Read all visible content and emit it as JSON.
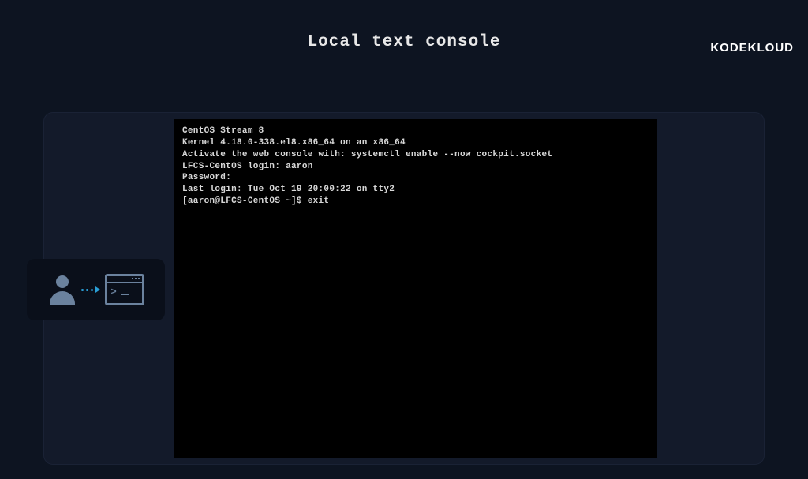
{
  "brand": "KODEKLOUD",
  "title": "Local text console",
  "terminal": {
    "lines": [
      "CentOS Stream 8",
      "Kernel 4.18.0-338.el8.x86_64 on an x86_64",
      "",
      "Activate the web console with: systemctl enable --now cockpit.socket",
      "",
      "LFCS-CentOS login: aaron",
      "Password:",
      "Last login: Tue Oct 19 20:00:22 on tty2",
      "[aaron@LFCS-CentOS ~]$ exit"
    ]
  }
}
